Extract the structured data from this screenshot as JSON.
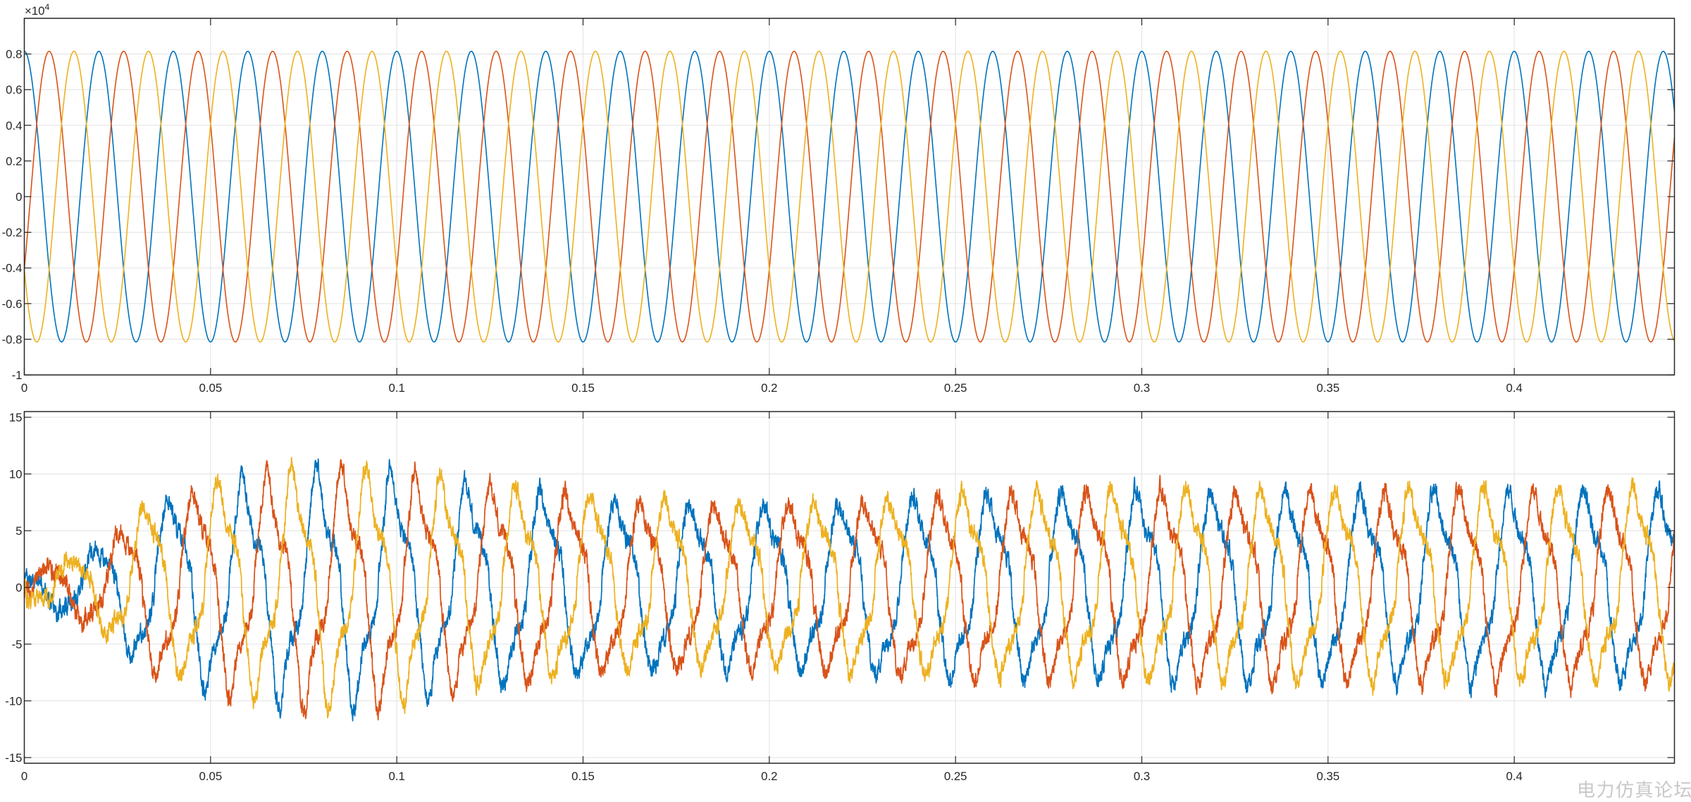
{
  "colors": {
    "series_1": "#0072BD",
    "series_2": "#D95319",
    "series_3": "#EDB120",
    "grid": "#e6e6e6",
    "axes": "#262626",
    "background": "#ffffff"
  },
  "watermark": "电力仿真论坛",
  "chart_data": [
    {
      "type": "line",
      "title": "",
      "xlabel": "",
      "ylabel": "",
      "xlim": [
        0,
        0.443
      ],
      "ylim": [
        -1,
        1
      ],
      "y_exponent_label": "×10",
      "y_exponent_power": "4",
      "grid": true,
      "legend": "none",
      "x_ticks": [
        0,
        0.05,
        0.1,
        0.15,
        0.2,
        0.25,
        0.3,
        0.35,
        0.4
      ],
      "x_tick_labels": [
        "0",
        "0.05",
        "0.1",
        "0.15",
        "0.2",
        "0.25",
        "0.3",
        "0.35",
        "0.4"
      ],
      "y_ticks": [
        -1,
        -0.8,
        -0.6,
        -0.4,
        -0.2,
        0,
        0.2,
        0.4,
        0.6,
        0.8
      ],
      "y_tick_labels": [
        "-1",
        "-0.8",
        "-0.6",
        "-0.4",
        "-0.2",
        "0",
        "0.2",
        "0.4",
        "0.6",
        "0.8"
      ],
      "signal": {
        "kind": "three-phase sine",
        "amplitude": 0.815,
        "frequency_hz": 50,
        "start_phase_deg": [
          90,
          -30,
          210
        ]
      },
      "series": [
        {
          "color_key": "series_1"
        },
        {
          "color_key": "series_2"
        },
        {
          "color_key": "series_3"
        }
      ]
    },
    {
      "type": "line",
      "title": "",
      "xlabel": "",
      "ylabel": "",
      "xlim": [
        0,
        0.443
      ],
      "ylim": [
        -15.5,
        15.5
      ],
      "grid": true,
      "legend": "none",
      "x_ticks": [
        0,
        0.05,
        0.1,
        0.15,
        0.2,
        0.25,
        0.3,
        0.35,
        0.4
      ],
      "x_tick_labels": [
        "0",
        "0.05",
        "0.1",
        "0.15",
        "0.2",
        "0.25",
        "0.3",
        "0.35",
        "0.4"
      ],
      "y_ticks": [
        -15,
        -10,
        -5,
        0,
        5,
        10,
        15
      ],
      "y_tick_labels": [
        "-15",
        "-10",
        "-5",
        "0",
        "5",
        "10",
        "15"
      ],
      "signal": {
        "kind": "distorted three-phase current",
        "frequency_hz": 50,
        "peak_envelope": [
          [
            0,
            1
          ],
          [
            0.02,
            4
          ],
          [
            0.035,
            8
          ],
          [
            0.06,
            10.5
          ],
          [
            0.08,
            11.5
          ],
          [
            0.1,
            11
          ],
          [
            0.12,
            9.5
          ],
          [
            0.16,
            8
          ],
          [
            0.2,
            7.5
          ],
          [
            0.25,
            8.5
          ],
          [
            0.3,
            9
          ],
          [
            0.443,
            9
          ]
        ],
        "plateau_level": 5,
        "start_phase_deg": [
          90,
          -30,
          210
        ]
      },
      "series": [
        {
          "color_key": "series_1"
        },
        {
          "color_key": "series_2"
        },
        {
          "color_key": "series_3"
        }
      ]
    }
  ]
}
